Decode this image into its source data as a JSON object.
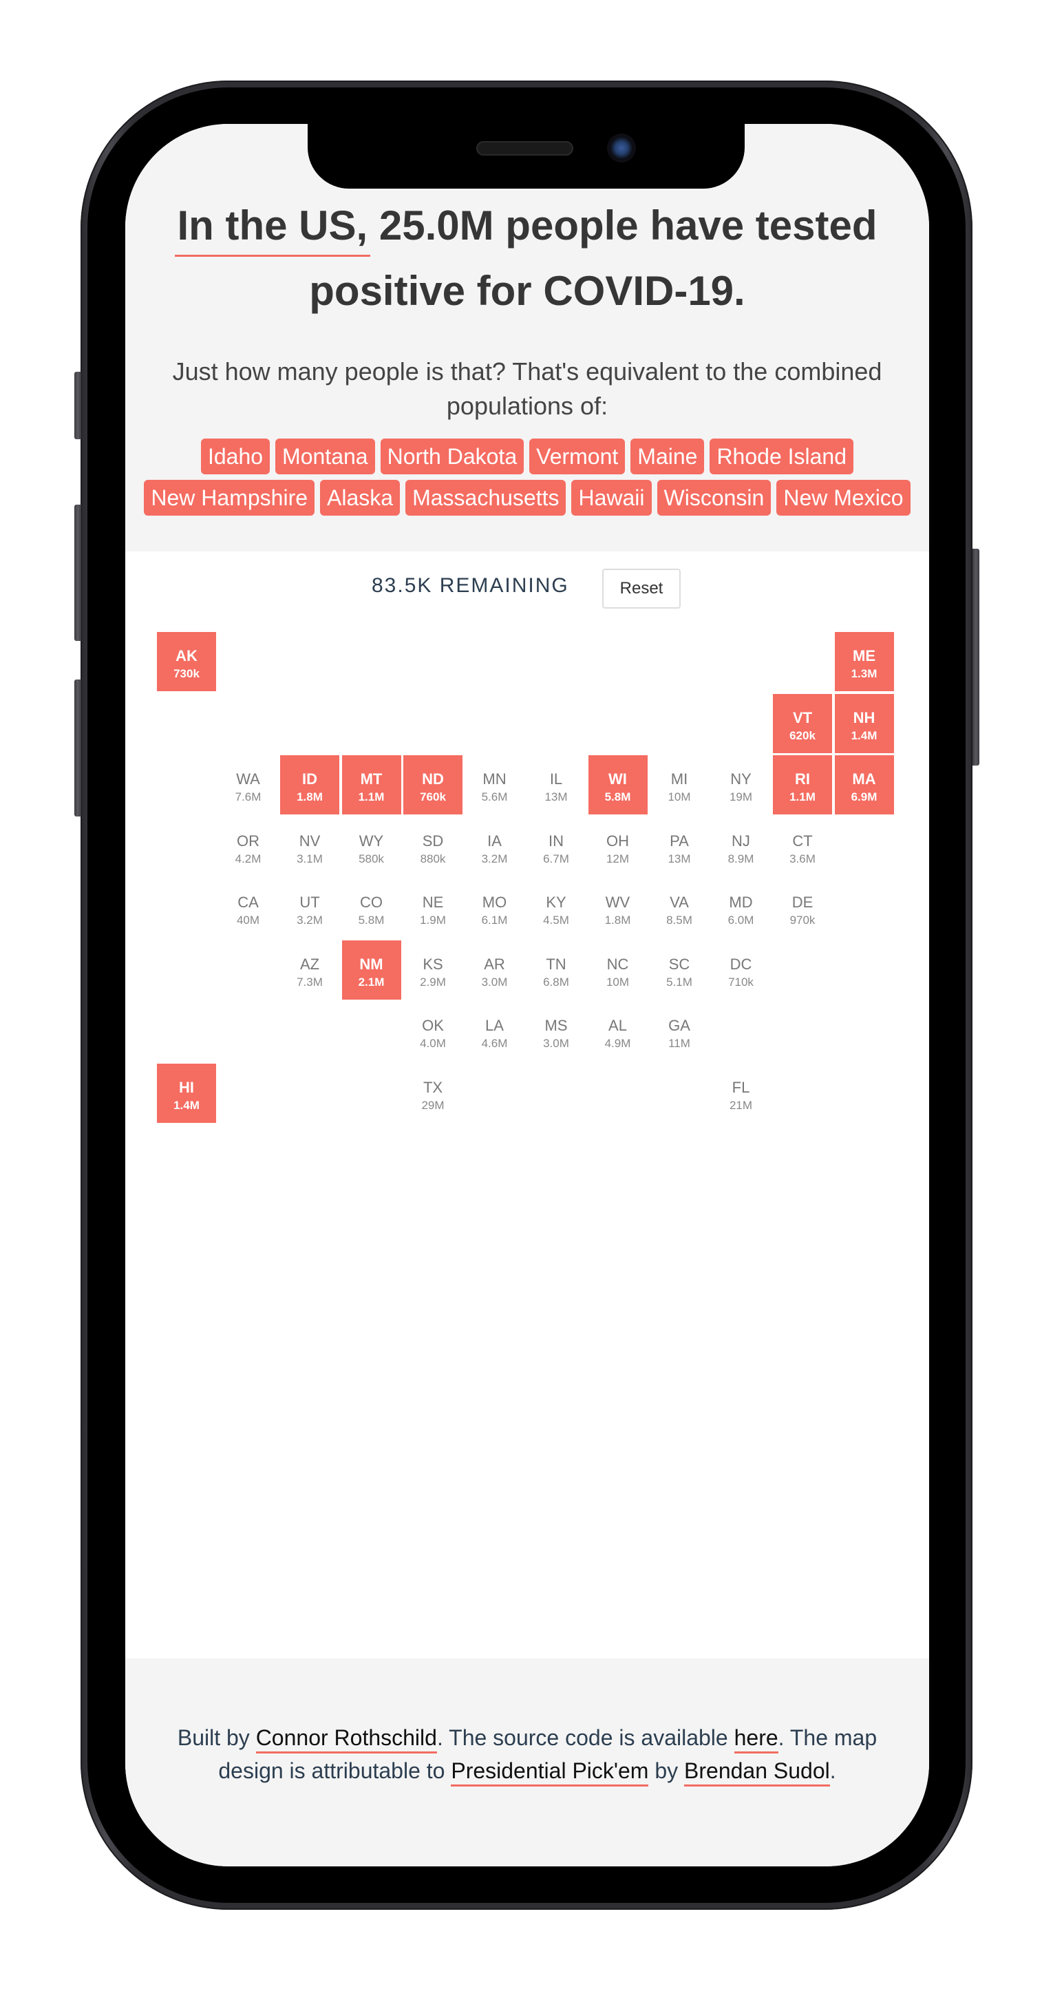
{
  "header": {
    "title_highlight": "In the US,",
    "title_rest": " 25.0M people have tested positive for COVID-19.",
    "subtitle": "Just how many people is that? That's equivalent to the combined populations of:"
  },
  "state_tags": [
    "Idaho",
    "Montana",
    "North Dakota",
    "Vermont",
    "Maine",
    "Rhode Island",
    "New Hampshire",
    "Alaska",
    "Massachusetts",
    "Hawaii",
    "Wisconsin",
    "New Mexico"
  ],
  "controls": {
    "remaining_label": "83.5K REMAINING",
    "reset_label": "Reset"
  },
  "colors": {
    "accent": "#f56c61",
    "text_dark": "#363636",
    "text_slate": "#2c3e50",
    "hero_bg": "#f4f4f4"
  },
  "grid_map": [
    {
      "abbr": "AK",
      "pop": "730k",
      "selected": true,
      "row": 0,
      "col": 0
    },
    {
      "abbr": "ME",
      "pop": "1.3M",
      "selected": true,
      "row": 0,
      "col": 11
    },
    {
      "abbr": "VT",
      "pop": "620k",
      "selected": true,
      "row": 1,
      "col": 10
    },
    {
      "abbr": "NH",
      "pop": "1.4M",
      "selected": true,
      "row": 1,
      "col": 11
    },
    {
      "abbr": "WA",
      "pop": "7.6M",
      "selected": false,
      "row": 2,
      "col": 1
    },
    {
      "abbr": "ID",
      "pop": "1.8M",
      "selected": true,
      "row": 2,
      "col": 2
    },
    {
      "abbr": "MT",
      "pop": "1.1M",
      "selected": true,
      "row": 2,
      "col": 3
    },
    {
      "abbr": "ND",
      "pop": "760k",
      "selected": true,
      "row": 2,
      "col": 4
    },
    {
      "abbr": "MN",
      "pop": "5.6M",
      "selected": false,
      "row": 2,
      "col": 5
    },
    {
      "abbr": "IL",
      "pop": "13M",
      "selected": false,
      "row": 2,
      "col": 6
    },
    {
      "abbr": "WI",
      "pop": "5.8M",
      "selected": true,
      "row": 2,
      "col": 7
    },
    {
      "abbr": "MI",
      "pop": "10M",
      "selected": false,
      "row": 2,
      "col": 8
    },
    {
      "abbr": "NY",
      "pop": "19M",
      "selected": false,
      "row": 2,
      "col": 9
    },
    {
      "abbr": "RI",
      "pop": "1.1M",
      "selected": true,
      "row": 2,
      "col": 10
    },
    {
      "abbr": "MA",
      "pop": "6.9M",
      "selected": true,
      "row": 2,
      "col": 11
    },
    {
      "abbr": "OR",
      "pop": "4.2M",
      "selected": false,
      "row": 3,
      "col": 1
    },
    {
      "abbr": "NV",
      "pop": "3.1M",
      "selected": false,
      "row": 3,
      "col": 2
    },
    {
      "abbr": "WY",
      "pop": "580k",
      "selected": false,
      "row": 3,
      "col": 3
    },
    {
      "abbr": "SD",
      "pop": "880k",
      "selected": false,
      "row": 3,
      "col": 4
    },
    {
      "abbr": "IA",
      "pop": "3.2M",
      "selected": false,
      "row": 3,
      "col": 5
    },
    {
      "abbr": "IN",
      "pop": "6.7M",
      "selected": false,
      "row": 3,
      "col": 6
    },
    {
      "abbr": "OH",
      "pop": "12M",
      "selected": false,
      "row": 3,
      "col": 7
    },
    {
      "abbr": "PA",
      "pop": "13M",
      "selected": false,
      "row": 3,
      "col": 8
    },
    {
      "abbr": "NJ",
      "pop": "8.9M",
      "selected": false,
      "row": 3,
      "col": 9
    },
    {
      "abbr": "CT",
      "pop": "3.6M",
      "selected": false,
      "row": 3,
      "col": 10
    },
    {
      "abbr": "CA",
      "pop": "40M",
      "selected": false,
      "row": 4,
      "col": 1
    },
    {
      "abbr": "UT",
      "pop": "3.2M",
      "selected": false,
      "row": 4,
      "col": 2
    },
    {
      "abbr": "CO",
      "pop": "5.8M",
      "selected": false,
      "row": 4,
      "col": 3
    },
    {
      "abbr": "NE",
      "pop": "1.9M",
      "selected": false,
      "row": 4,
      "col": 4
    },
    {
      "abbr": "MO",
      "pop": "6.1M",
      "selected": false,
      "row": 4,
      "col": 5
    },
    {
      "abbr": "KY",
      "pop": "4.5M",
      "selected": false,
      "row": 4,
      "col": 6
    },
    {
      "abbr": "WV",
      "pop": "1.8M",
      "selected": false,
      "row": 4,
      "col": 7
    },
    {
      "abbr": "VA",
      "pop": "8.5M",
      "selected": false,
      "row": 4,
      "col": 8
    },
    {
      "abbr": "MD",
      "pop": "6.0M",
      "selected": false,
      "row": 4,
      "col": 9
    },
    {
      "abbr": "DE",
      "pop": "970k",
      "selected": false,
      "row": 4,
      "col": 10
    },
    {
      "abbr": "AZ",
      "pop": "7.3M",
      "selected": false,
      "row": 5,
      "col": 2
    },
    {
      "abbr": "NM",
      "pop": "2.1M",
      "selected": true,
      "row": 5,
      "col": 3
    },
    {
      "abbr": "KS",
      "pop": "2.9M",
      "selected": false,
      "row": 5,
      "col": 4
    },
    {
      "abbr": "AR",
      "pop": "3.0M",
      "selected": false,
      "row": 5,
      "col": 5
    },
    {
      "abbr": "TN",
      "pop": "6.8M",
      "selected": false,
      "row": 5,
      "col": 6
    },
    {
      "abbr": "NC",
      "pop": "10M",
      "selected": false,
      "row": 5,
      "col": 7
    },
    {
      "abbr": "SC",
      "pop": "5.1M",
      "selected": false,
      "row": 5,
      "col": 8
    },
    {
      "abbr": "DC",
      "pop": "710k",
      "selected": false,
      "row": 5,
      "col": 9
    },
    {
      "abbr": "OK",
      "pop": "4.0M",
      "selected": false,
      "row": 6,
      "col": 4
    },
    {
      "abbr": "LA",
      "pop": "4.6M",
      "selected": false,
      "row": 6,
      "col": 5
    },
    {
      "abbr": "MS",
      "pop": "3.0M",
      "selected": false,
      "row": 6,
      "col": 6
    },
    {
      "abbr": "AL",
      "pop": "4.9M",
      "selected": false,
      "row": 6,
      "col": 7
    },
    {
      "abbr": "GA",
      "pop": "11M",
      "selected": false,
      "row": 6,
      "col": 8
    },
    {
      "abbr": "HI",
      "pop": "1.4M",
      "selected": true,
      "row": 7,
      "col": 0
    },
    {
      "abbr": "TX",
      "pop": "29M",
      "selected": false,
      "row": 7,
      "col": 4
    },
    {
      "abbr": "FL",
      "pop": "21M",
      "selected": false,
      "row": 7,
      "col": 9
    }
  ],
  "footer": {
    "t1": "Built by ",
    "link_author": "Connor Rothschild",
    "t2": ". The source code is available ",
    "link_source": "here",
    "t3": ". The map design is attributable to ",
    "link_design": "Presidential Pick'em",
    "t4": " by ",
    "link_designer": "Brendan Sudol",
    "t5": "."
  }
}
